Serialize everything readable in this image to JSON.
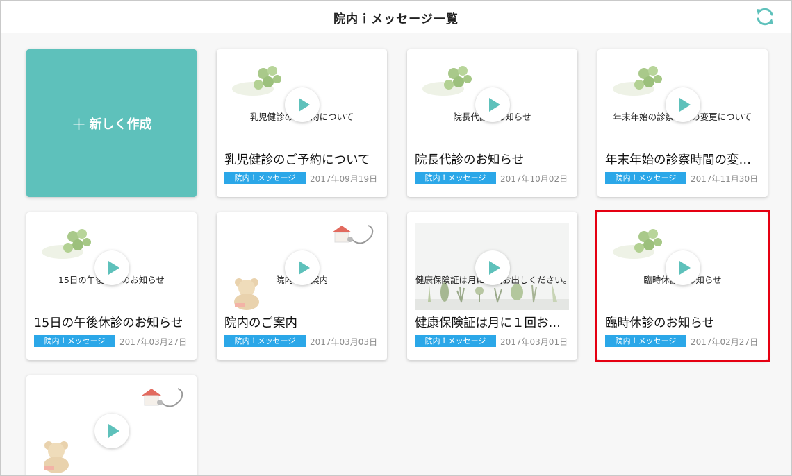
{
  "header": {
    "title": "院内ｉメッセージ一覧",
    "refresh_icon": "refresh-icon",
    "accent": "#5ec1bb"
  },
  "create_card": {
    "plus": "＋",
    "label": "新しく作成"
  },
  "colors": {
    "accent": "#5ec1bb",
    "badge": "#2ba7e8",
    "highlight": "#e50012"
  },
  "cards": [
    {
      "thumb_text": "乳児健診のご予約について",
      "title": "乳児健診のご予約について",
      "badge": "院内ｉメッセージ",
      "date": "2017年09月19日",
      "thumb": "clover"
    },
    {
      "thumb_text": "院長代診のお知らせ",
      "title": "院長代診のお知らせ",
      "badge": "院内ｉメッセージ",
      "date": "2017年10月02日",
      "thumb": "clover"
    },
    {
      "thumb_text": "年末年始の診察時間の変更について",
      "title": "年末年始の診察時間の変…",
      "badge": "院内ｉメッセージ",
      "date": "2017年11月30日",
      "thumb": "clover"
    },
    {
      "thumb_text": "15日の午後休診のお知らせ",
      "title": "15日の午後休診のお知らせ",
      "badge": "院内ｉメッセージ",
      "date": "2017年03月27日",
      "thumb": "clover"
    },
    {
      "thumb_text": "院内のご案内",
      "title": "院内のご案内",
      "badge": "院内ｉメッセージ",
      "date": "2017年03月03日",
      "thumb": "bear-house"
    },
    {
      "thumb_text": "健康保険証は月に１回お出しください。",
      "title": "健康保険証は月に１回お…",
      "badge": "院内ｉメッセージ",
      "date": "2017年03月01日",
      "thumb": "plants"
    },
    {
      "thumb_text": "臨時休診のお知らせ",
      "title": "臨時休診のお知らせ",
      "badge": "院内ｉメッセージ",
      "date": "2017年02月27日",
      "thumb": "clover",
      "selected": true
    },
    {
      "thumb_text": "",
      "title": "",
      "badge": "",
      "date": "",
      "thumb": "bear-house"
    }
  ]
}
